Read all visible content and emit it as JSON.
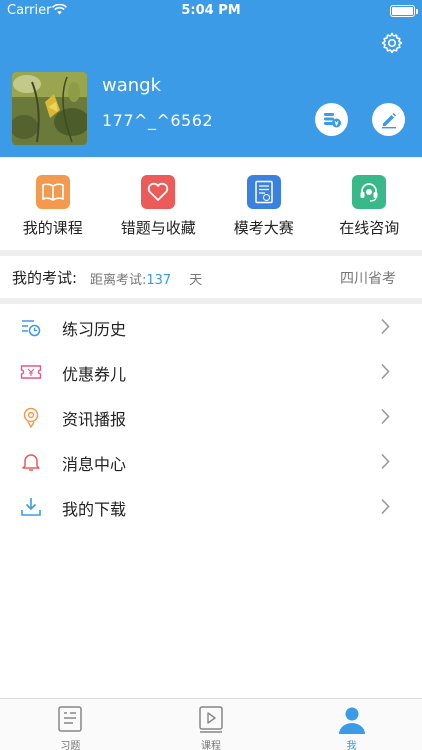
{
  "status_bar": {
    "carrier": "Carrier",
    "time": "5:04 PM"
  },
  "profile": {
    "username": "wangk",
    "phone": "177^_^6562",
    "avatar": "leaf-photo"
  },
  "quick_actions": [
    {
      "label": "我的课程",
      "icon": "book-icon",
      "color": "#f39a4e"
    },
    {
      "label": "错题与收藏",
      "icon": "heart-icon",
      "color": "#ec5a5a"
    },
    {
      "label": "模考大赛",
      "icon": "exam-paper-icon",
      "color": "#3b82e0"
    },
    {
      "label": "在线咨询",
      "icon": "headset-icon",
      "color": "#39b98a"
    }
  ],
  "exam": {
    "title": "我的考试:",
    "countdown_prefix": "距离考试:",
    "days": "137",
    "unit": "天",
    "province": "四川省考"
  },
  "menu": [
    {
      "label": "练习历史",
      "icon": "history-icon"
    },
    {
      "label": "优惠券儿",
      "icon": "coupon-icon"
    },
    {
      "label": "资讯播报",
      "icon": "broadcast-icon"
    },
    {
      "label": "消息中心",
      "icon": "bell-icon"
    },
    {
      "label": "我的下载",
      "icon": "download-icon"
    }
  ],
  "tabs": [
    {
      "label": "习题",
      "icon": "exercise-icon",
      "active": false
    },
    {
      "label": "课程",
      "icon": "play-icon",
      "active": false
    },
    {
      "label": "我",
      "icon": "person-icon",
      "active": true
    }
  ],
  "colors": {
    "primary": "#3b9be7",
    "separator": "#eeeeee"
  }
}
